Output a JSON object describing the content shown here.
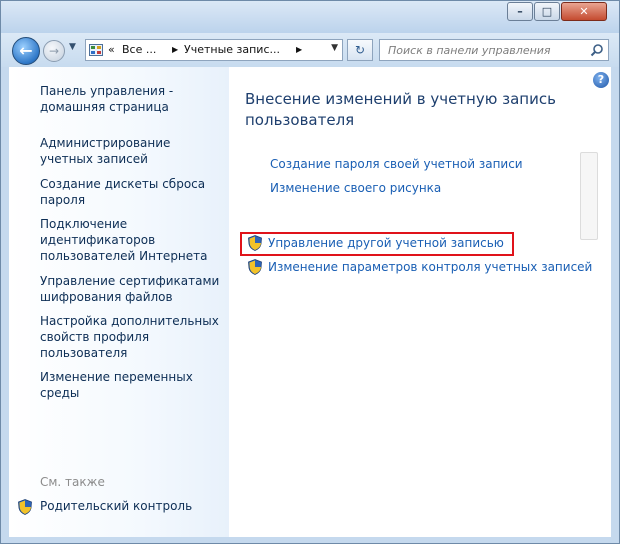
{
  "window": {
    "minimize_label": "–",
    "maximize_label": "□",
    "close_label": "✕"
  },
  "navbar": {
    "back_glyph": "←",
    "forward_glyph": "→",
    "breadcrumb_overflow": "«",
    "breadcrumb": [
      "Все ...",
      "Учетные запис..."
    ],
    "refresh_glyph": "↻",
    "search_placeholder": "Поиск в панели управления"
  },
  "sidebar": {
    "links": [
      "Панель управления - домашняя страница",
      "Администрирование учетных записей",
      "Создание дискеты сброса пароля",
      "Подключение идентификаторов пользователей Интернета",
      "Управление сертификатами шифрования файлов",
      "Настройка дополнительных свойств профиля пользователя",
      "Изменение переменных среды"
    ],
    "see_also": "См. также",
    "parental_control": "Родительский контроль"
  },
  "main": {
    "title": "Внесение изменений в учетную запись пользователя",
    "tasks": [
      "Создание пароля своей учетной записи",
      "Изменение своего рисунка",
      "Управление другой учетной записью",
      "Изменение параметров контроля учетных записей"
    ],
    "help_label": "?"
  },
  "colors": {
    "link": "#1a5fb4",
    "title": "#1e3f6e",
    "highlight": "#e0131a",
    "frame": "#c5d9ee"
  }
}
